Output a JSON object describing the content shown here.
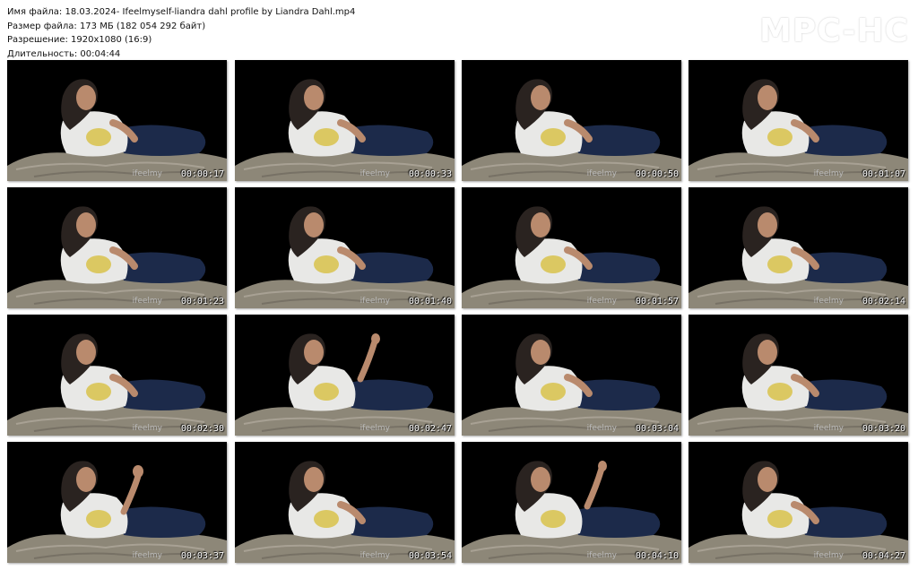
{
  "file_info": {
    "name_line": "Имя файла: 18.03.2024- Ifeelmyself-liandra dahl profile by Liandra Dahl.mp4",
    "size_line": "Размер файла: 173 МБ (182 054 292 байт)",
    "resolution_line": "Разрешение: 1920x1080 (16:9)",
    "duration_line": "Длительность: 00:04:44"
  },
  "logo": "MPC-HC",
  "watermark_text": "ifeelmy",
  "colors": {
    "background": "#ffffff",
    "frame_bg": "#000000",
    "shirt": "#e8e8e6",
    "jeans": "#1c2a4a",
    "blanket": "#8d8778",
    "skin": "#b98a6d",
    "hair": "#2a2320"
  },
  "thumbnails": [
    {
      "time": "00:00:17"
    },
    {
      "time": "00:00:33"
    },
    {
      "time": "00:00:50"
    },
    {
      "time": "00:01:07"
    },
    {
      "time": "00:01:23"
    },
    {
      "time": "00:01:40"
    },
    {
      "time": "00:01:57"
    },
    {
      "time": "00:02:14"
    },
    {
      "time": "00:02:30"
    },
    {
      "time": "00:02:47"
    },
    {
      "time": "00:03:04"
    },
    {
      "time": "00:03:20"
    },
    {
      "time": "00:03:37"
    },
    {
      "time": "00:03:54"
    },
    {
      "time": "00:04:10"
    },
    {
      "time": "00:04:27"
    }
  ]
}
